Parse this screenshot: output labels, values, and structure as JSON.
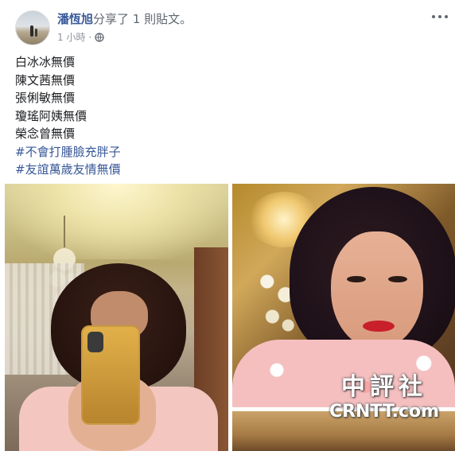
{
  "post": {
    "author_name": "潘恆旭",
    "action_text": "分享了 1 則貼文。",
    "timestamp": "1 小時",
    "audience_icon": "globe-icon",
    "menu_icon": "more-options-icon"
  },
  "body": {
    "lines": [
      "白冰冰無價",
      "陳文茜無價",
      "張俐敏無價",
      "瓊瑤阿姨無價",
      "榮念曾無價"
    ],
    "hashtags": [
      "#不會打腫臉充胖子",
      "#友誼萬歲友情無價"
    ]
  },
  "watermark": {
    "chinese": "中評社",
    "english": "CRNTT.com"
  },
  "colors": {
    "link": "#385898",
    "meta": "#90949c"
  }
}
